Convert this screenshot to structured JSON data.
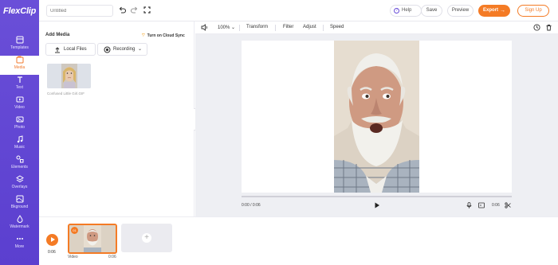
{
  "app": {
    "logo_text": "FlexClip",
    "brand_color": "#5b3fcf",
    "accent_color": "#f47b25"
  },
  "sidebar": {
    "items": [
      {
        "label": "Templates",
        "icon": "templates-icon",
        "active": false
      },
      {
        "label": "Media",
        "icon": "media-icon",
        "active": true
      },
      {
        "label": "Text",
        "icon": "text-icon",
        "active": false
      },
      {
        "label": "Video",
        "icon": "video-icon",
        "active": false
      },
      {
        "label": "Photo",
        "icon": "photo-icon",
        "active": false
      },
      {
        "label": "Music",
        "icon": "music-icon",
        "active": false
      },
      {
        "label": "Elements",
        "icon": "elements-icon",
        "active": false
      },
      {
        "label": "Overlays",
        "icon": "overlays-icon",
        "active": false
      },
      {
        "label": "Bkground",
        "icon": "background-icon",
        "active": false
      },
      {
        "label": "Watermark",
        "icon": "watermark-icon",
        "active": false
      },
      {
        "label": "More",
        "icon": "more-icon",
        "active": false
      }
    ]
  },
  "topbar": {
    "title_placeholder": "Untitled",
    "help_label": "Help",
    "save_label": "Save",
    "preview_label": "Preview",
    "export_label": "Export",
    "signup_label": "Sign Up"
  },
  "media_panel": {
    "title": "Add Media",
    "cloud_sync_label": "Turn on Cloud Sync",
    "local_files_label": "Local Files",
    "recording_label": "Recording",
    "thumbnail_caption": "Confused Little Girl.GIF"
  },
  "editor_toolbar": {
    "zoom": "100%",
    "transform_label": "Transform",
    "filter_label": "Filter",
    "adjust_label": "Adjust",
    "speed_label": "Speed"
  },
  "player": {
    "current_time": "0:00 / 0:06",
    "duration": "0:06"
  },
  "timeline": {
    "total_time": "0:06",
    "clip_number": "01",
    "clip_label": "Video",
    "clip_duration": "0:06"
  }
}
